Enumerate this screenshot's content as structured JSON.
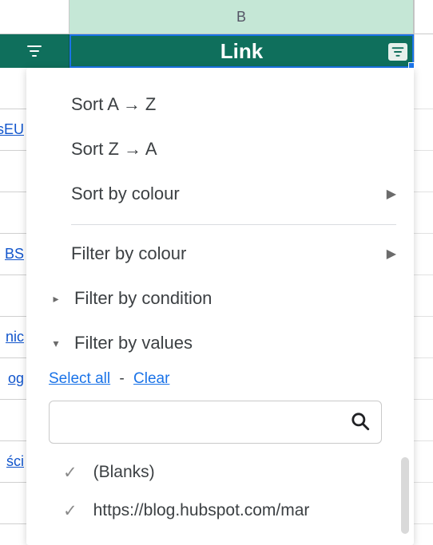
{
  "column": {
    "letter": "B",
    "title": "Link"
  },
  "bg_left_fragments": [
    "",
    "sEU",
    "",
    "",
    "BS",
    "",
    "nic",
    "og",
    "",
    "ści",
    ""
  ],
  "menu": {
    "sort_az": "Sort A → Z",
    "sort_za": "Sort Z → A",
    "sort_colour": "Sort by colour",
    "filter_colour": "Filter by colour",
    "filter_condition": "Filter by condition",
    "filter_values": "Filter by values"
  },
  "links": {
    "select_all": "Select all",
    "clear": "Clear"
  },
  "search": {
    "placeholder": ""
  },
  "values": [
    {
      "label": "(Blanks)",
      "checked": true
    },
    {
      "label": "https://blog.hubspot.com/mar",
      "checked": true
    }
  ]
}
